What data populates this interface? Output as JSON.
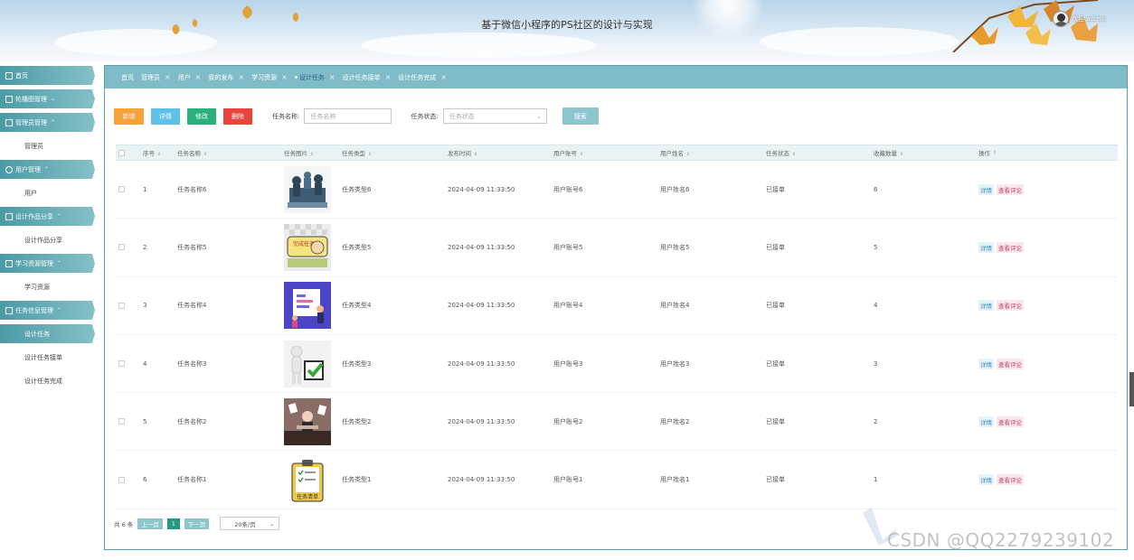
{
  "header": {
    "title": "基于微信小程序的PS社区的设计与实现",
    "welcome": "欢迎 admin"
  },
  "sidebar": {
    "groups": [
      {
        "label": "首页",
        "icon": "home-icon",
        "subs": []
      },
      {
        "label": "轮播图管理",
        "icon": "carousel-icon",
        "subs": []
      },
      {
        "label": "管理员管理",
        "icon": "admin-icon",
        "subs": [
          "管理员"
        ]
      },
      {
        "label": "用户管理",
        "icon": "user-icon",
        "subs": [
          "用户"
        ]
      },
      {
        "label": "设计作品分享",
        "icon": "grid-icon",
        "subs": [
          "设计作品分享"
        ]
      },
      {
        "label": "学习资源管理",
        "icon": "book-icon",
        "subs": [
          "学习资源"
        ]
      },
      {
        "label": "任务信息管理",
        "icon": "task-icon",
        "subs": [
          "设计任务",
          "设计任务接单",
          "设计任务完成"
        ]
      }
    ],
    "active_sub": "设计任务"
  },
  "tabs": [
    {
      "label": "首页",
      "closable": false
    },
    {
      "label": "管理员",
      "closable": true
    },
    {
      "label": "用户",
      "closable": true
    },
    {
      "label": "我的发布",
      "closable": true
    },
    {
      "label": "学习资源",
      "closable": true
    },
    {
      "label": "设计任务",
      "closable": true,
      "active": true
    },
    {
      "label": "设计任务接单",
      "closable": true
    },
    {
      "label": "设计任务完成",
      "closable": true
    }
  ],
  "toolbar": {
    "add": "新增",
    "detail": "详情",
    "edit": "修改",
    "delete": "删除",
    "name_label": "任务名称:",
    "name_placeholder": "任务名称",
    "status_label": "任务状态:",
    "status_placeholder": "任务状态",
    "search": "搜索"
  },
  "table": {
    "columns": [
      "序号",
      "任务名称",
      "任务图片",
      "任务类型",
      "发布时间",
      "用户账号",
      "用户姓名",
      "任务状态",
      "收藏数量",
      "操作"
    ],
    "rows": [
      {
        "no": "1",
        "name": "任务名称6",
        "image": "puzzle-people",
        "type": "任务类型6",
        "time": "2024-04-09 11:33:50",
        "account": "用户账号6",
        "uname": "用户姓名6",
        "status": "已接单",
        "count": "6"
      },
      {
        "no": "2",
        "name": "任务名称5",
        "image": "completed-task-sticker",
        "type": "任务类型5",
        "time": "2024-04-09 11:33:50",
        "account": "用户账号5",
        "uname": "用户姓名5",
        "status": "已接单",
        "count": "5"
      },
      {
        "no": "3",
        "name": "任务名称4",
        "image": "planning-board",
        "type": "任务类型4",
        "time": "2024-04-09 11:33:50",
        "account": "用户账号4",
        "uname": "用户姓名4",
        "status": "已接单",
        "count": "4"
      },
      {
        "no": "4",
        "name": "任务名称3",
        "image": "checkmark-figure",
        "type": "任务类型3",
        "time": "2024-04-09 11:33:50",
        "account": "用户账号3",
        "uname": "用户姓名3",
        "status": "已接单",
        "count": "3"
      },
      {
        "no": "5",
        "name": "任务名称2",
        "image": "busy-desk",
        "type": "任务类型2",
        "time": "2024-04-09 11:33:50",
        "account": "用户账号2",
        "uname": "用户姓名2",
        "status": "已接单",
        "count": "2"
      },
      {
        "no": "6",
        "name": "任务名称1",
        "image": "task-clipboard",
        "type": "任务类型1",
        "time": "2024-04-09 11:33:50",
        "account": "用户账号1",
        "uname": "用户姓名1",
        "status": "已接单",
        "count": "1"
      }
    ],
    "op_detail": "详情",
    "op_comment": "查看评论"
  },
  "pager": {
    "total": "共 6 条",
    "prev": "上一页",
    "current": "1",
    "next": "下一页",
    "size": "20条/页"
  },
  "thumb_text": {
    "done": "完成任务",
    "list": "任务清单"
  },
  "watermark": "CSDN @QQ2279239102",
  "colors": {
    "accent": "#7fbcc8",
    "sidebar": "#4a9ba6",
    "add": "#f5a23a",
    "detail": "#5fc0e8",
    "edit": "#2ab07b",
    "delete": "#e8453c"
  }
}
